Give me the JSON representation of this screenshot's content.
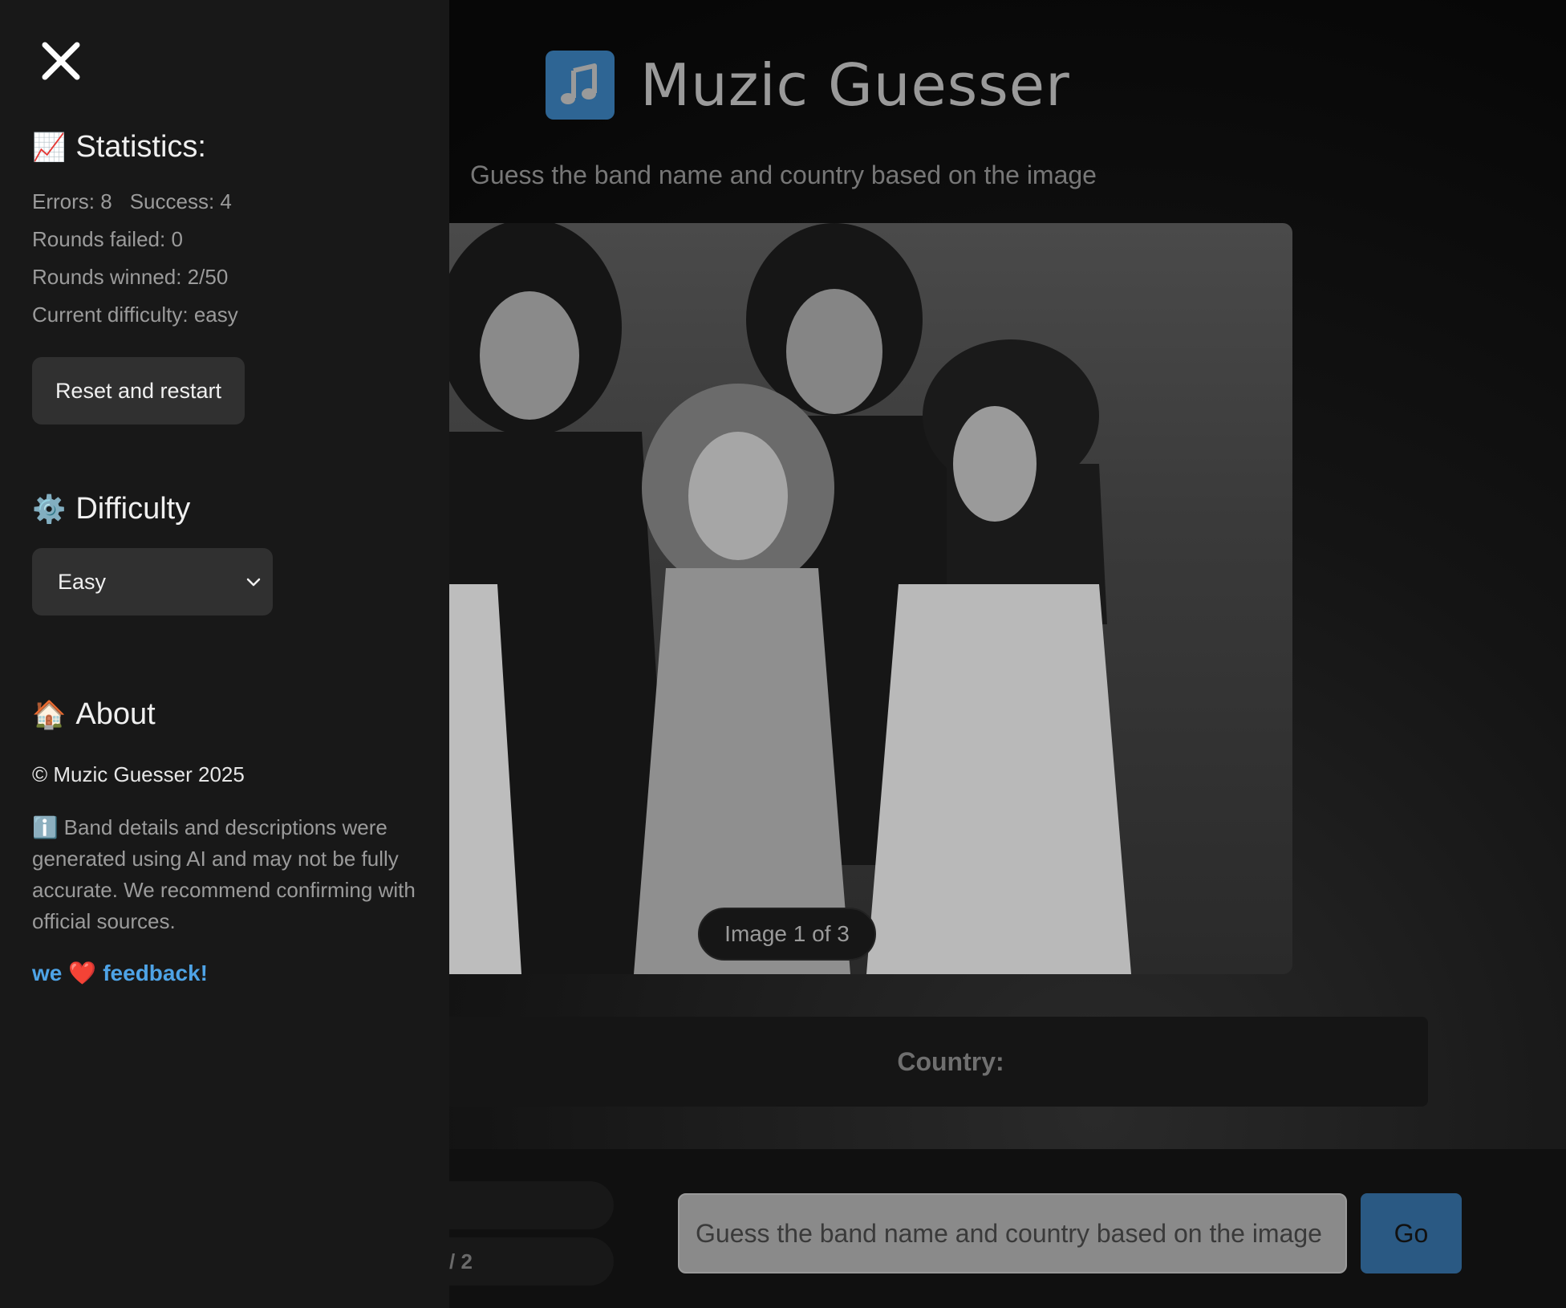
{
  "app": {
    "title": "Muzic Guesser",
    "subtitle": "Guess the band name and country based on the image",
    "logo_icon": "music-note-icon",
    "logo_color": "#2e6594"
  },
  "image_viewer": {
    "counter": "Image 1 of 3"
  },
  "answer": {
    "country_label": "Country:"
  },
  "bottom": {
    "pill_2_text": "/ 2",
    "guess_placeholder": "Guess the band name and country based on the image",
    "go_label": "Go",
    "go_color": "#2a5983"
  },
  "sidebar": {
    "close_icon": "close-icon",
    "statistics": {
      "emoji": "📈",
      "title": "Statistics:",
      "errors": "Errors: 8",
      "success": "Success: 4",
      "rounds_failed": "Rounds failed: 0",
      "rounds_winned": "Rounds winned: 2/50",
      "current_difficulty": "Current difficulty: easy",
      "reset_label": "Reset and restart"
    },
    "difficulty": {
      "emoji": "⚙️",
      "title": "Difficulty",
      "selected": "Easy"
    },
    "about": {
      "emoji": "🏠",
      "title": "About",
      "copyright": "© Muzic Guesser 2025",
      "disclaimer": "ℹ️ Band details and descriptions were generated using AI and may not be fully accurate. We recommend confirming with official sources.",
      "feedback_we": "we",
      "feedback_heart": "❤️",
      "feedback_link": "feedback!",
      "link_color": "#4ea3e6"
    }
  }
}
